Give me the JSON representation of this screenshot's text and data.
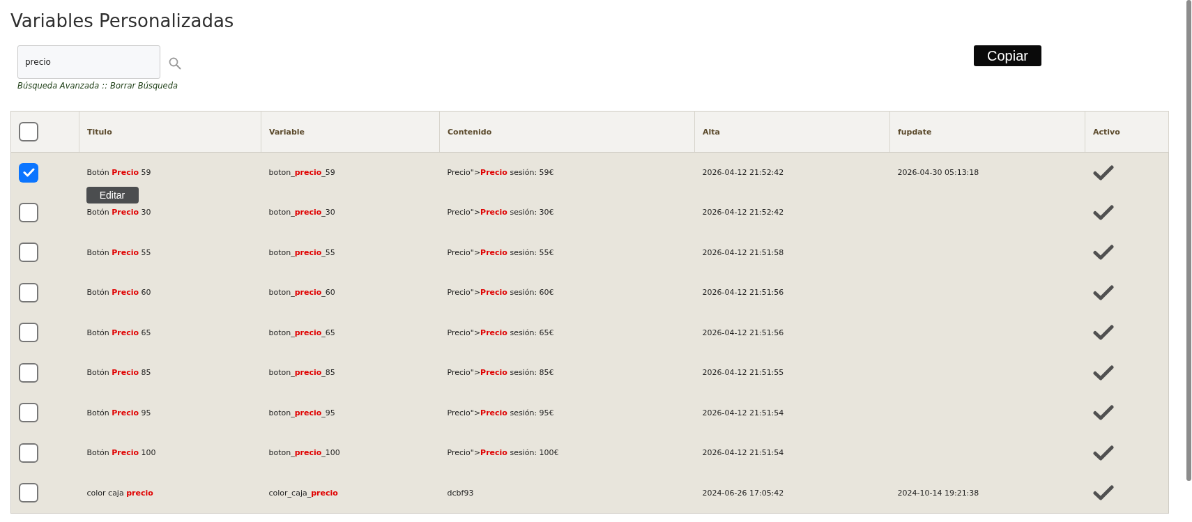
{
  "title": "Variables Personalizadas",
  "search": {
    "value": "precio",
    "links": [
      "Búsqueda Avanzada",
      "Borrar Búsqueda"
    ],
    "separator": "::"
  },
  "copy_button": "Copiar",
  "table": {
    "select_all_checked": false,
    "columns": [
      {
        "label": "Titulo"
      },
      {
        "label": "Variable"
      },
      {
        "label": "Contenido"
      },
      {
        "label": "Alta"
      },
      {
        "label": "fupdate"
      },
      {
        "label": "Activo"
      }
    ],
    "rows": [
      {
        "selected": true,
        "title": "Botón **Precio** 59",
        "action": "Editar",
        "variable": "boton_**precio**_59",
        "content": "Precio\">**Precio** sesión: 59€",
        "created": "2026-04-12 21:52:42",
        "updated": "2026-04-30 05:13:18",
        "active": true
      },
      {
        "selected": false,
        "title": "Botón **Precio** 30",
        "variable": "boton_**precio**_30",
        "content": "Precio\">**Precio** sesión: 30€",
        "created": "2026-04-12 21:52:42",
        "active": true
      },
      {
        "selected": false,
        "title": "Botón **Precio** 55",
        "variable": "boton_**precio**_55",
        "content": "Precio\">**Precio** sesión: 55€",
        "created": "2026-04-12 21:51:58",
        "active": true
      },
      {
        "selected": false,
        "title": "Botón **Precio** 60",
        "variable": "boton_**precio**_60",
        "content": "Precio\">**Precio** sesión: 60€",
        "created": "2026-04-12 21:51:56",
        "active": true
      },
      {
        "selected": false,
        "title": "Botón **Precio** 65",
        "variable": "boton_**precio**_65",
        "content": "Precio\">**Precio** sesión: 65€",
        "created": "2026-04-12 21:51:56",
        "active": true
      },
      {
        "selected": false,
        "title": "Botón **Precio** 85",
        "variable": "boton_**precio**_85",
        "content": "Precio\">**Precio** sesión: 85€",
        "created": "2026-04-12 21:51:55",
        "active": true
      },
      {
        "selected": false,
        "title": "Botón **Precio** 95",
        "variable": "boton_**precio**_95",
        "content": "Precio\">**Precio** sesión: 95€",
        "created": "2026-04-12 21:51:54",
        "active": true
      },
      {
        "selected": false,
        "title": "Botón **Precio** 100",
        "variable": "boton_**precio**_100",
        "content": "Precio\">**Precio** sesión: 100€",
        "created": "2026-04-12 21:51:54",
        "active": true
      },
      {
        "selected": false,
        "title": "color caja **precio**",
        "variable": "color_caja_**precio**",
        "content": "dcbf93",
        "created": "2024-06-26 17:05:42",
        "updated": "2024-10-14 19:21:38",
        "active": true
      }
    ]
  }
}
